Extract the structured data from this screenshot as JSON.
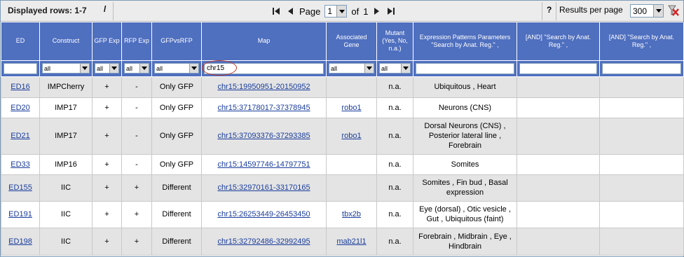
{
  "pager": {
    "displayed_rows": "Displayed rows: 1-7",
    "slash": "/",
    "page_label": "Page",
    "page_value": "1",
    "of_label": "of",
    "total_pages": "1",
    "help": "?",
    "results_per_page_label": "Results per page",
    "results_per_page_value": "300"
  },
  "columns": [
    {
      "key": "ed",
      "label": "ED"
    },
    {
      "key": "construct",
      "label": "Construct"
    },
    {
      "key": "gfp",
      "label": "GFP Exp"
    },
    {
      "key": "rfp",
      "label": "RFP Exp"
    },
    {
      "key": "gfpvsrfp",
      "label": "GFPvsRFP"
    },
    {
      "key": "map",
      "label": "Map"
    },
    {
      "key": "gene",
      "label": "Associated Gene"
    },
    {
      "key": "mutant",
      "label": "Mutant (Yes, No, n.a.)"
    },
    {
      "key": "expr",
      "label": "Expression Patterns Parameters \"Search by Anat. Reg.\" ,"
    },
    {
      "key": "and1",
      "label": "[AND] \"Search by Anat. Reg.\" ,"
    },
    {
      "key": "and2",
      "label": "[AND] \"Search by Anat. Reg.\" ,"
    }
  ],
  "filters": {
    "ed": "",
    "construct": "all",
    "gfp": "all",
    "rfp": "all",
    "gfpvsrfp": "all",
    "map": "chr15",
    "gene": "all",
    "mutant": "all",
    "expr": "",
    "and1": "",
    "and2": ""
  },
  "rows": [
    {
      "ed": "ED16",
      "construct": "IMPCherry",
      "gfp": "+",
      "rfp": "-",
      "gfpvsrfp": "Only GFP",
      "map": "chr15:19950951-20150952",
      "gene": "",
      "mutant": "n.a.",
      "expr": "Ubiquitous , Heart",
      "and1": "",
      "and2": ""
    },
    {
      "ed": "ED20",
      "construct": "IMP17",
      "gfp": "+",
      "rfp": "-",
      "gfpvsrfp": "Only GFP",
      "map": "chr15:37178017-37378945",
      "gene": "robo1",
      "mutant": "n.a.",
      "expr": "Neurons (CNS)",
      "and1": "",
      "and2": ""
    },
    {
      "ed": "ED21",
      "construct": "IMP17",
      "gfp": "+",
      "rfp": "-",
      "gfpvsrfp": "Only GFP",
      "map": "chr15:37093376-37293385",
      "gene": "robo1",
      "mutant": "n.a.",
      "expr": "Dorsal Neurons (CNS) , Posterior lateral line , Forebrain",
      "and1": "",
      "and2": ""
    },
    {
      "ed": "ED33",
      "construct": "IMP16",
      "gfp": "+",
      "rfp": "-",
      "gfpvsrfp": "Only GFP",
      "map": "chr15:14597746-14797751",
      "gene": "",
      "mutant": "n.a.",
      "expr": "Somites",
      "and1": "",
      "and2": ""
    },
    {
      "ed": "ED155",
      "construct": "IIC",
      "gfp": "+",
      "rfp": "+",
      "gfpvsrfp": "Different",
      "map": "chr15:32970161-33170165",
      "gene": "",
      "mutant": "n.a.",
      "expr": "Somites , Fin bud , Basal expression",
      "and1": "",
      "and2": ""
    },
    {
      "ed": "ED191",
      "construct": "IIC",
      "gfp": "+",
      "rfp": "+",
      "gfpvsrfp": "Different",
      "map": "chr15:26253449-26453450",
      "gene": "tbx2b",
      "mutant": "n.a.",
      "expr": "Eye (dorsal) , Otic vesicle , Gut , Ubiquitous (faint)",
      "and1": "",
      "and2": ""
    },
    {
      "ed": "ED198",
      "construct": "IIC",
      "gfp": "+",
      "rfp": "+",
      "gfpvsrfp": "Different",
      "map": "chr15:32792486-32992495",
      "gene": "mab21l1",
      "mutant": "n.a.",
      "expr": "Forebrain , Midbrain , Eye , Hindbrain",
      "and1": "",
      "and2": ""
    }
  ]
}
